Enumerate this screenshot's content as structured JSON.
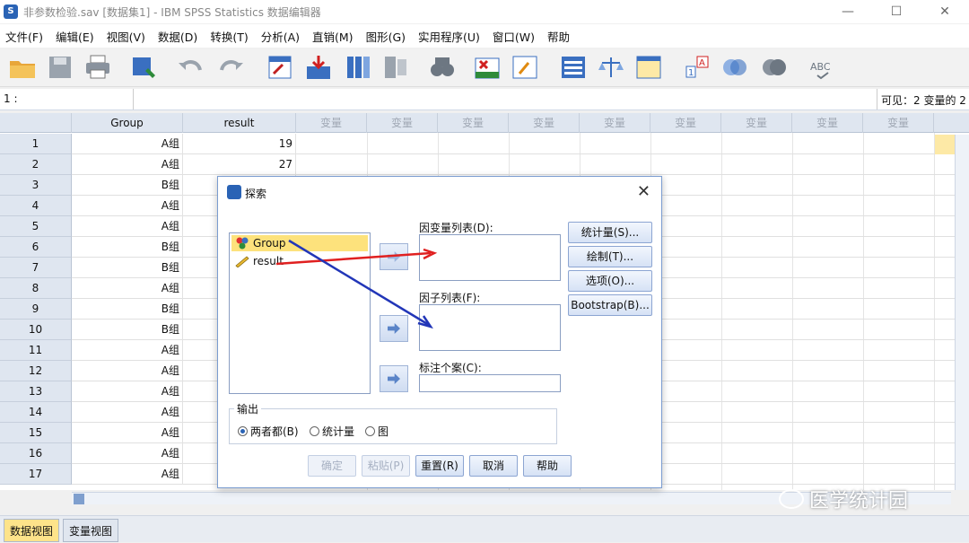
{
  "window": {
    "title": "非参数检验.sav [数据集1] - IBM SPSS Statistics 数据编辑器",
    "controls": [
      "—",
      "☐",
      "✕"
    ]
  },
  "menu": [
    "文件(F)",
    "编辑(E)",
    "视图(V)",
    "数据(D)",
    "转换(T)",
    "分析(A)",
    "直销(M)",
    "图形(G)",
    "实用程序(U)",
    "窗口(W)",
    "帮助"
  ],
  "cellbar": {
    "ref": "1 :",
    "visible": "可见：2 变量的 2"
  },
  "grid": {
    "headers": [
      "Group",
      "result",
      "变量",
      "变量",
      "变量",
      "变量",
      "变量",
      "变量",
      "变量",
      "变量",
      "变量"
    ],
    "rows": [
      {
        "n": "1",
        "group": "A组",
        "result": "19"
      },
      {
        "n": "2",
        "group": "A组",
        "result": "27"
      },
      {
        "n": "3",
        "group": "B组",
        "result": ""
      },
      {
        "n": "4",
        "group": "A组",
        "result": ""
      },
      {
        "n": "5",
        "group": "A组",
        "result": ""
      },
      {
        "n": "6",
        "group": "B组",
        "result": ""
      },
      {
        "n": "7",
        "group": "B组",
        "result": ""
      },
      {
        "n": "8",
        "group": "A组",
        "result": ""
      },
      {
        "n": "9",
        "group": "B组",
        "result": ""
      },
      {
        "n": "10",
        "group": "B组",
        "result": ""
      },
      {
        "n": "11",
        "group": "A组",
        "result": ""
      },
      {
        "n": "12",
        "group": "A组",
        "result": ""
      },
      {
        "n": "13",
        "group": "A组",
        "result": ""
      },
      {
        "n": "14",
        "group": "A组",
        "result": ""
      },
      {
        "n": "15",
        "group": "A组",
        "result": ""
      },
      {
        "n": "16",
        "group": "A组",
        "result": ""
      },
      {
        "n": "17",
        "group": "A组",
        "result": ""
      }
    ]
  },
  "tabs": {
    "data_view": "数据视图",
    "variable_view": "变量视图"
  },
  "dialog": {
    "title": "探索",
    "variables": [
      "Group",
      "result"
    ],
    "dependent_label": "因变量列表(D):",
    "factor_label": "因子列表(F):",
    "label_cases": "标注个案(C):",
    "side_buttons": [
      "统计量(S)...",
      "绘制(T)...",
      "选项(O)...",
      "Bootstrap(B)..."
    ],
    "output_title": "输出",
    "output_options": [
      "两者都(B)",
      "统计量",
      "图"
    ],
    "bottom_buttons": [
      "确定",
      "粘贴(P)",
      "重置(R)",
      "取消",
      "帮助"
    ]
  },
  "watermark": "医学统计园",
  "colors": {
    "annotation_red": "#e02020",
    "annotation_blue": "#2236b8",
    "selection": "#fde27c"
  }
}
